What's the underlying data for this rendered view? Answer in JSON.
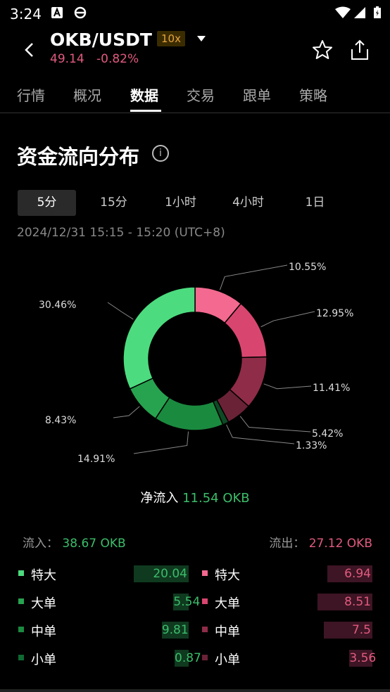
{
  "status": {
    "time": "3:24"
  },
  "header": {
    "pair": "OKB/USDT",
    "leverage": "10x",
    "price": "49.14",
    "change": "-0.82%"
  },
  "tabs": [
    "行情",
    "概况",
    "数据",
    "交易",
    "跟单",
    "策略"
  ],
  "active_tab": "数据",
  "section": {
    "title": "资金流向分布",
    "info": "i"
  },
  "intervals": [
    "5分",
    "15分",
    "1小时",
    "4小时",
    "1日"
  ],
  "active_interval": "5分",
  "date_range": "2024/12/31 15:15 - 15:20 (UTC+8)",
  "donut": {
    "slices": [
      {
        "label": "10.55%",
        "value": 10.55,
        "color": "#f4698f"
      },
      {
        "label": "12.95%",
        "value": 12.95,
        "color": "#d8466f"
      },
      {
        "label": "11.41%",
        "value": 11.41,
        "color": "#8f2c48"
      },
      {
        "label": "5.42%",
        "value": 5.42,
        "color": "#6a2236"
      },
      {
        "label": "1.33%",
        "value": 1.33,
        "color": "#0e4a25"
      },
      {
        "label": "14.91%",
        "value": 14.91,
        "color": "#1a8a3f"
      },
      {
        "label": "8.43%",
        "value": 8.43,
        "color": "#27a34f"
      },
      {
        "label": "30.46%",
        "value": 30.46,
        "color": "#4cdc7f"
      }
    ]
  },
  "net_flow": {
    "label": "净流入",
    "value": "11.54 OKB"
  },
  "inflow": {
    "label": "流入：",
    "value": "38.67 OKB"
  },
  "outflow": {
    "label": "流出：",
    "value": "27.12 OKB"
  },
  "in_rows": [
    {
      "label": "特大",
      "value": "20.04",
      "color": "#4cdc7f"
    },
    {
      "label": "大单",
      "value": "5.54",
      "color": "#27a34f"
    },
    {
      "label": "中单",
      "value": "9.81",
      "color": "#1a8a3f"
    },
    {
      "label": "小单",
      "value": "0.87",
      "color": "#0e6a32"
    }
  ],
  "out_rows": [
    {
      "label": "特大",
      "value": "6.94",
      "color": "#f4698f"
    },
    {
      "label": "大单",
      "value": "8.51",
      "color": "#d8466f"
    },
    {
      "label": "中单",
      "value": "7.5",
      "color": "#8f2c48"
    },
    {
      "label": "小单",
      "value": "3.56",
      "color": "#6a2236"
    }
  ]
}
